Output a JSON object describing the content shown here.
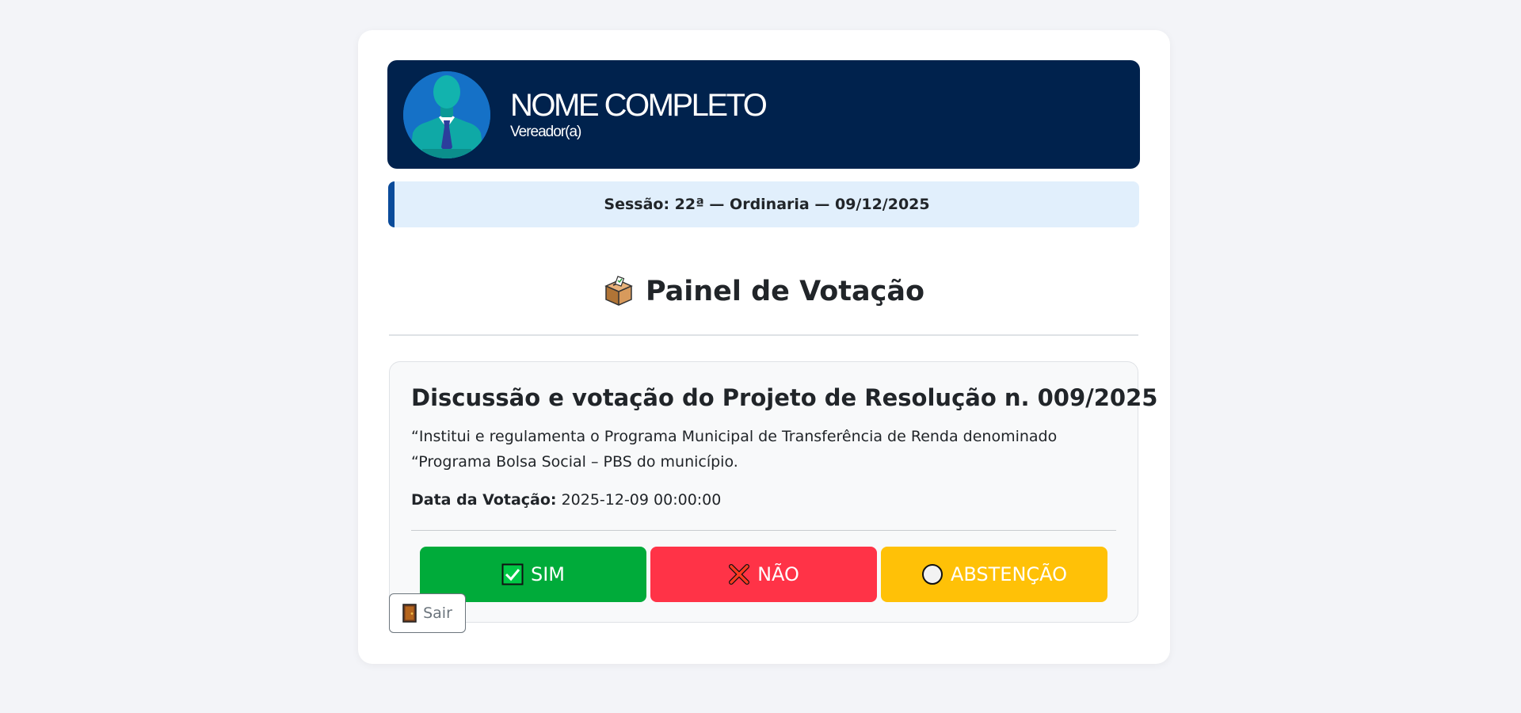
{
  "profile": {
    "name": "NOME COMPLETO",
    "role": "Vereador(a)",
    "avatar_icon": "user-avatar-suit-icon"
  },
  "session": {
    "text": "Sessão: 22ª — Ordinaria — 09/12/2025"
  },
  "panel": {
    "title": "Painel de Votação",
    "icon": "ballot-box-icon"
  },
  "vote": {
    "title": "Discussão e votação do Projeto de Resolução n. 009/2025",
    "description": "“Institui e regulamenta o Programa Municipal de Transferência de Renda denominado “Programa Bolsa Social – PBS do município.",
    "date_label": "Data da Votação:",
    "date_value": "2025-12-09 00:00:00"
  },
  "buttons": {
    "yes": {
      "label": "SIM",
      "icon": "check-box-icon",
      "color": "#00ab3a"
    },
    "no": {
      "label": "NÃO",
      "icon": "cross-mark-icon",
      "color": "#ff3347"
    },
    "abstain": {
      "label": "ABSTENÇÃO",
      "icon": "white-circle-icon",
      "color": "#ffc107"
    }
  },
  "exit": {
    "label": "Sair",
    "icon": "door-icon"
  },
  "colors": {
    "header_bg": "#00224d",
    "session_bg": "#e1effc",
    "session_accent": "#0a4b9a",
    "page_bg": "#f3f4f8"
  }
}
